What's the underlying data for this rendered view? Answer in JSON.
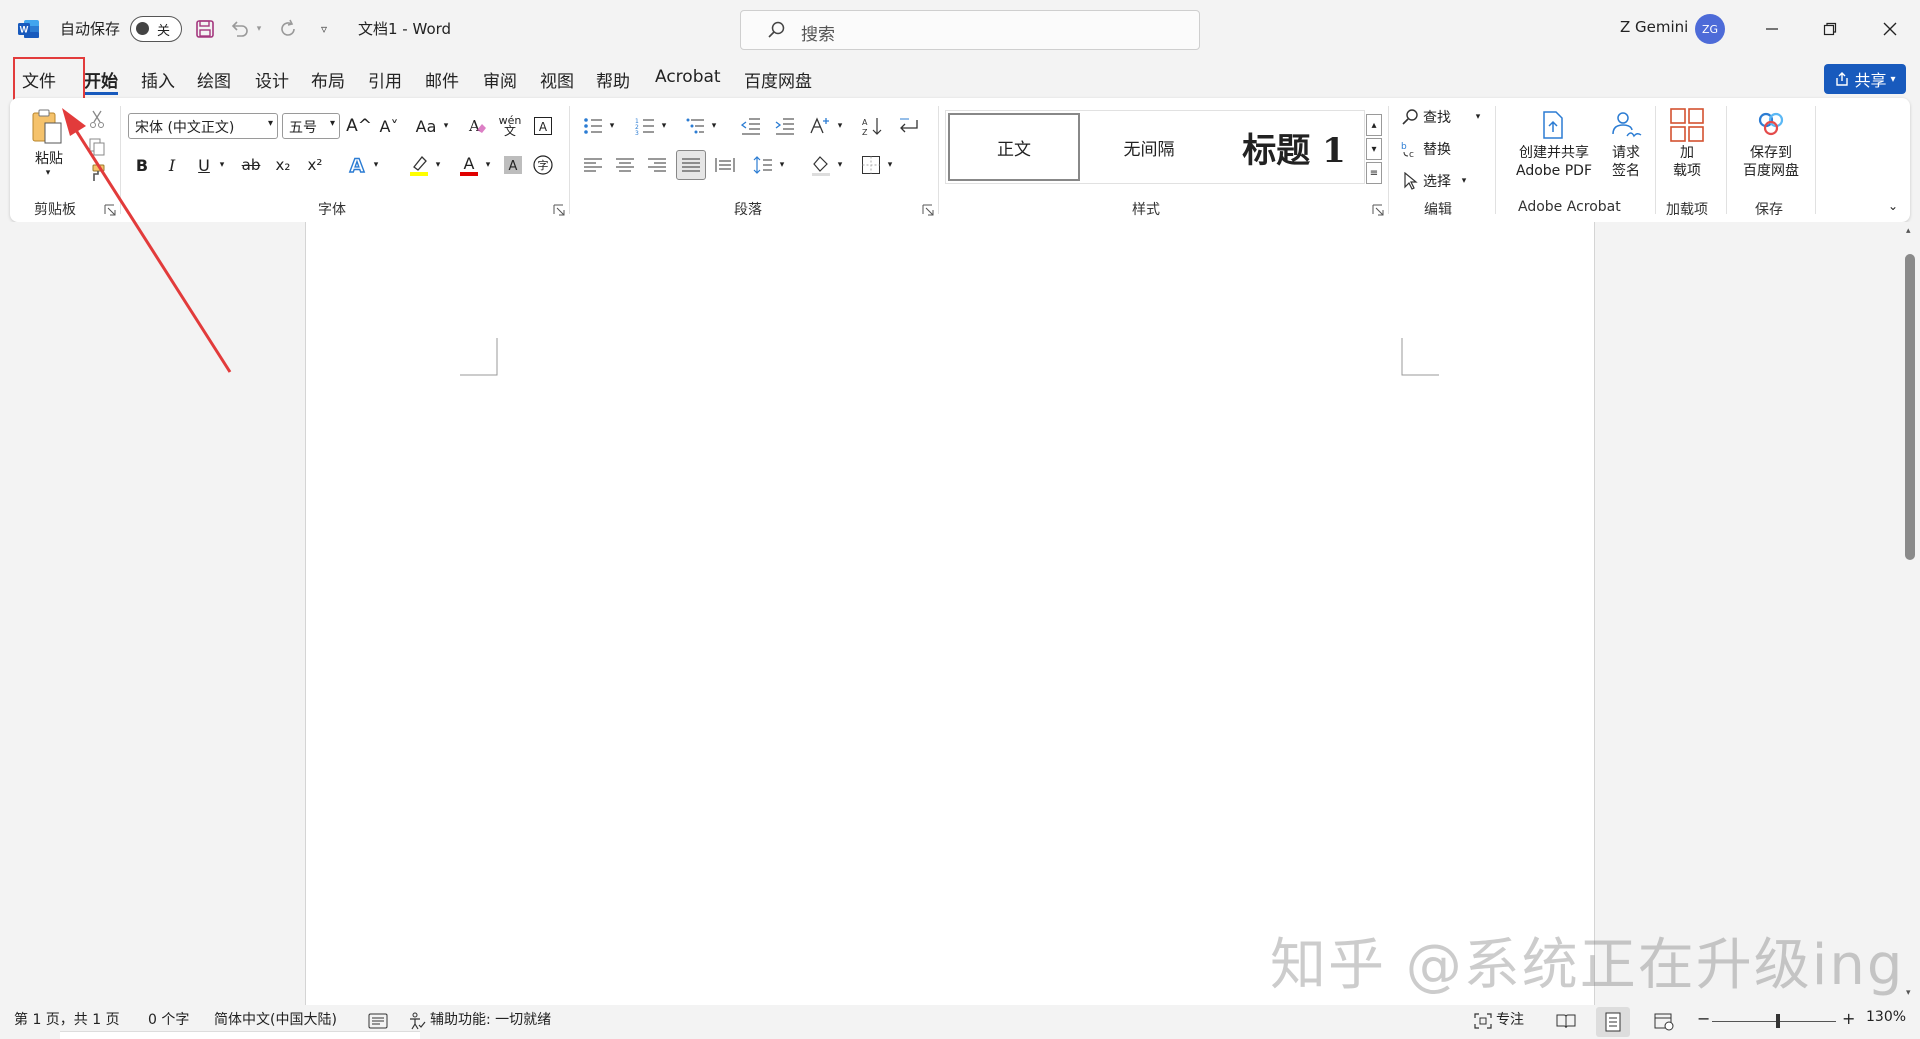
{
  "titlebar": {
    "autosave_label": "自动保存",
    "autosave_state": "关",
    "doc_title": "文档1  -  Word",
    "search_placeholder": "搜索",
    "user_name": "Z Gemini",
    "user_initials": "ZG"
  },
  "tabs": [
    "文件",
    "开始",
    "插入",
    "绘图",
    "设计",
    "布局",
    "引用",
    "邮件",
    "审阅",
    "视图",
    "帮助",
    "Acrobat",
    "百度网盘"
  ],
  "active_tab": "开始",
  "share_label": "共享",
  "ribbon": {
    "clipboard": {
      "paste_label": "粘贴",
      "group_label": "剪贴板"
    },
    "font": {
      "font_name": "宋体 (中文正文)",
      "font_size": "五号",
      "group_label": "字体",
      "bold": "B",
      "italic": "I",
      "underline": "U",
      "strike": "ab",
      "sub": "x₂",
      "sup": "x²",
      "grow": "A^",
      "shrink": "A˅",
      "case": "Aa",
      "wen": "wén",
      "font_a": "A"
    },
    "paragraph": {
      "group_label": "段落"
    },
    "styles": {
      "items": [
        "正文",
        "无间隔",
        "标题 1"
      ],
      "group_label": "样式"
    },
    "editing": {
      "find": "查找",
      "replace": "替换",
      "select": "选择",
      "group_label": "编辑"
    },
    "acrobat": {
      "create_pdf_line1": "创建并共享",
      "create_pdf_line2": "Adobe PDF",
      "sign_line1": "请求",
      "sign_line2": "签名",
      "group_label": "Adobe Acrobat"
    },
    "addins": {
      "line1": "加",
      "line2": "载项",
      "group_label": "加载项"
    },
    "save": {
      "line1": "保存到",
      "line2": "百度网盘",
      "group_label": "保存"
    }
  },
  "statusbar": {
    "page": "第 1 页，共 1 页",
    "words": "0 个字",
    "language": "简体中文(中国大陆)",
    "accessibility": "辅助功能: 一切就绪",
    "focus": "专注",
    "zoom": "130%"
  },
  "watermark": "知乎 @系统正在升级ing",
  "colors": {
    "accent": "#185abd",
    "highlight_box": "#e23b3b",
    "font_color_red": "#e00000",
    "highlight_yellow": "#ffff00"
  }
}
